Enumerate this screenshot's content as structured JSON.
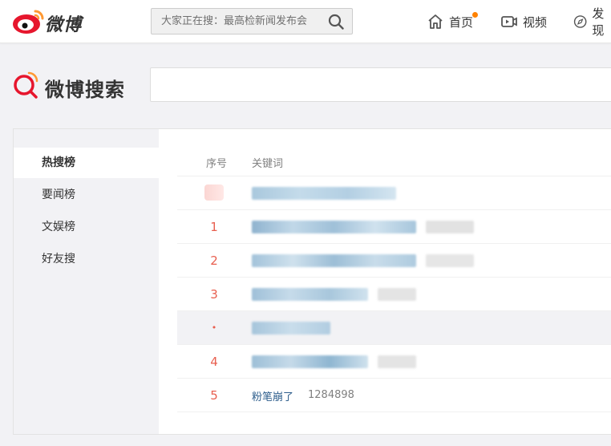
{
  "header": {
    "logo_text": "微博",
    "search_placeholder": "大家正在搜：最高检新闻发布会",
    "nav": [
      {
        "label": "首页",
        "icon": "home-icon"
      },
      {
        "label": "视频",
        "icon": "video-icon"
      },
      {
        "label": "发现",
        "icon": "compass-icon"
      }
    ],
    "accent": "#ff8200"
  },
  "search_page": {
    "title": "微博搜索",
    "input_value": ""
  },
  "sidebar": {
    "items": [
      {
        "label": "热搜榜",
        "active": true
      },
      {
        "label": "要闻榜",
        "active": false
      },
      {
        "label": "文娱榜",
        "active": false
      },
      {
        "label": "好友搜",
        "active": false
      }
    ]
  },
  "table": {
    "headers": {
      "rank": "序号",
      "keyword": "关键词"
    },
    "rows": [
      {
        "rank": "",
        "type": "pinned",
        "blurred": true
      },
      {
        "rank": "1",
        "type": "normal",
        "blurred": true
      },
      {
        "rank": "2",
        "type": "normal",
        "blurred": true
      },
      {
        "rank": "3",
        "type": "normal",
        "blurred": true
      },
      {
        "rank": "•",
        "type": "promo",
        "blurred": true
      },
      {
        "rank": "4",
        "type": "normal",
        "blurred": true
      },
      {
        "rank": "5",
        "type": "normal",
        "keyword": "粉笔崩了",
        "count": "1284898"
      }
    ]
  },
  "colors": {
    "rank": "#e85f4f",
    "link": "#2e5e8c",
    "muted": "#808080"
  }
}
